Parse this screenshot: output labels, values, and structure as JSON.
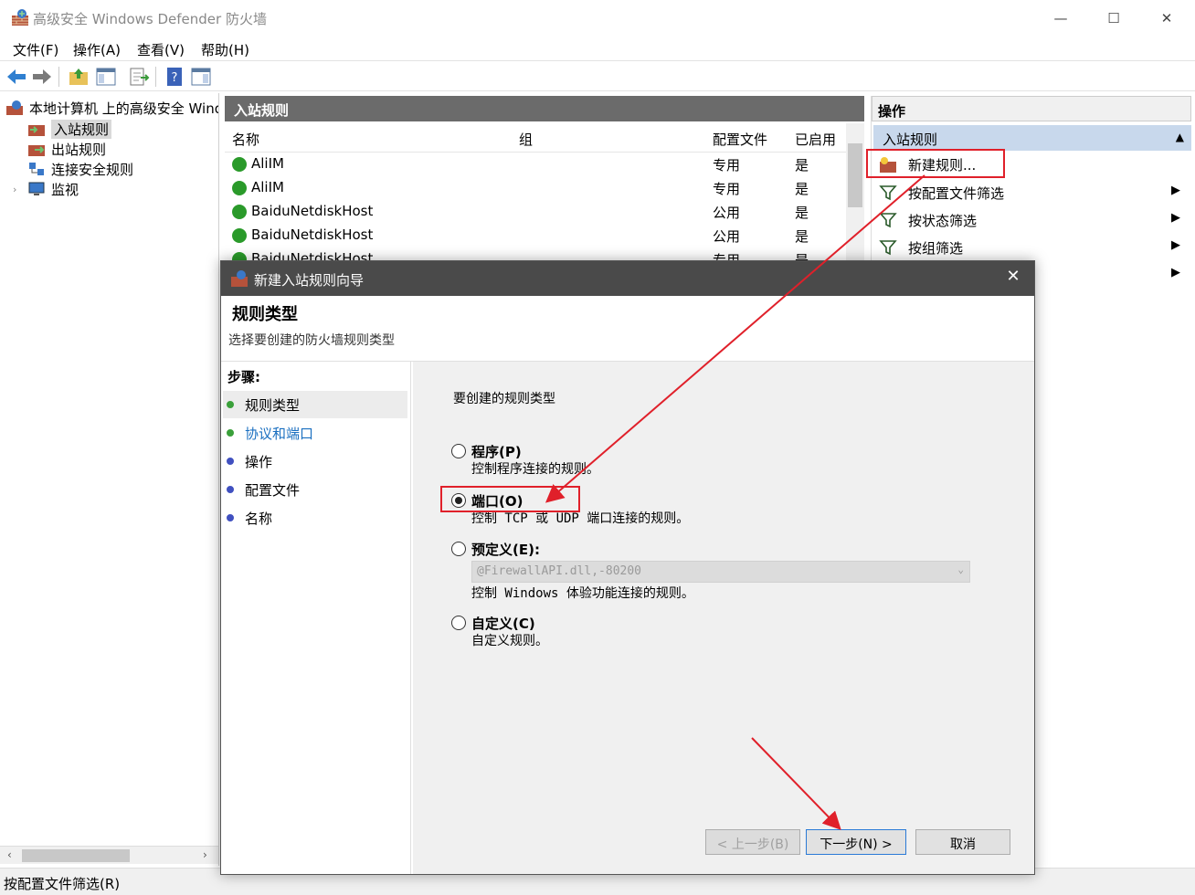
{
  "window": {
    "title": "高级安全 Windows Defender 防火墙",
    "min_icon": "—",
    "max_icon": "☐",
    "close_icon": "✕"
  },
  "menu": [
    "文件(F)",
    "操作(A)",
    "查看(V)",
    "帮助(H)"
  ],
  "tree": {
    "root": "本地计算机 上的高级安全 Windows",
    "items": [
      "入站规则",
      "出站规则",
      "连接安全规则",
      "监视"
    ],
    "selected": "入站规则"
  },
  "center": {
    "header": "入站规则",
    "columns": [
      "名称",
      "组",
      "配置文件",
      "已启用"
    ],
    "rows": [
      {
        "name": "AliIM",
        "group": "",
        "profile": "专用",
        "enabled": "是"
      },
      {
        "name": "AliIM",
        "group": "",
        "profile": "专用",
        "enabled": "是"
      },
      {
        "name": "BaiduNetdiskHost",
        "group": "",
        "profile": "公用",
        "enabled": "是"
      },
      {
        "name": "BaiduNetdiskHost",
        "group": "",
        "profile": "公用",
        "enabled": "是"
      },
      {
        "name": "BaiduNetdiskHost",
        "group": "",
        "profile": "专用",
        "enabled": "是"
      }
    ]
  },
  "actions": {
    "header": "操作",
    "section": "入站规则",
    "items": [
      "新建规则...",
      "按配置文件筛选",
      "按状态筛选",
      "按组筛选"
    ]
  },
  "statusbar": "按配置文件筛选(R)",
  "dialog": {
    "title": "新建入站规则向导",
    "heading": "规则类型",
    "subheading": "选择要创建的防火墙规则类型",
    "steps_title": "步骤:",
    "steps": [
      {
        "label": "规则类型",
        "color": "#3aa03a"
      },
      {
        "label": "协议和端口",
        "color": "#3aa03a"
      },
      {
        "label": "操作",
        "color": "#4050c0"
      },
      {
        "label": "配置文件",
        "color": "#4050c0"
      },
      {
        "label": "名称",
        "color": "#4050c0"
      }
    ],
    "prompt": "要创建的规则类型",
    "options": [
      {
        "label": "程序(P)",
        "desc": "控制程序连接的规则。",
        "selected": false
      },
      {
        "label": "端口(O)",
        "desc": "控制 TCP 或 UDP 端口连接的规则。",
        "selected": true
      },
      {
        "label": "预定义(E):",
        "desc": "控制 Windows 体验功能连接的规则。",
        "selected": false
      },
      {
        "label": "自定义(C)",
        "desc": "自定义规则。",
        "selected": false
      }
    ],
    "predefined_value": "@FirewallAPI.dll,-80200",
    "buttons": {
      "back": "< 上一步(B)",
      "next": "下一步(N) >",
      "cancel": "取消"
    }
  },
  "colors": {
    "annotation": "#e0202a",
    "dialog_title_bg": "#4a4a4a",
    "actions_section_bg": "#c8d8ec"
  }
}
